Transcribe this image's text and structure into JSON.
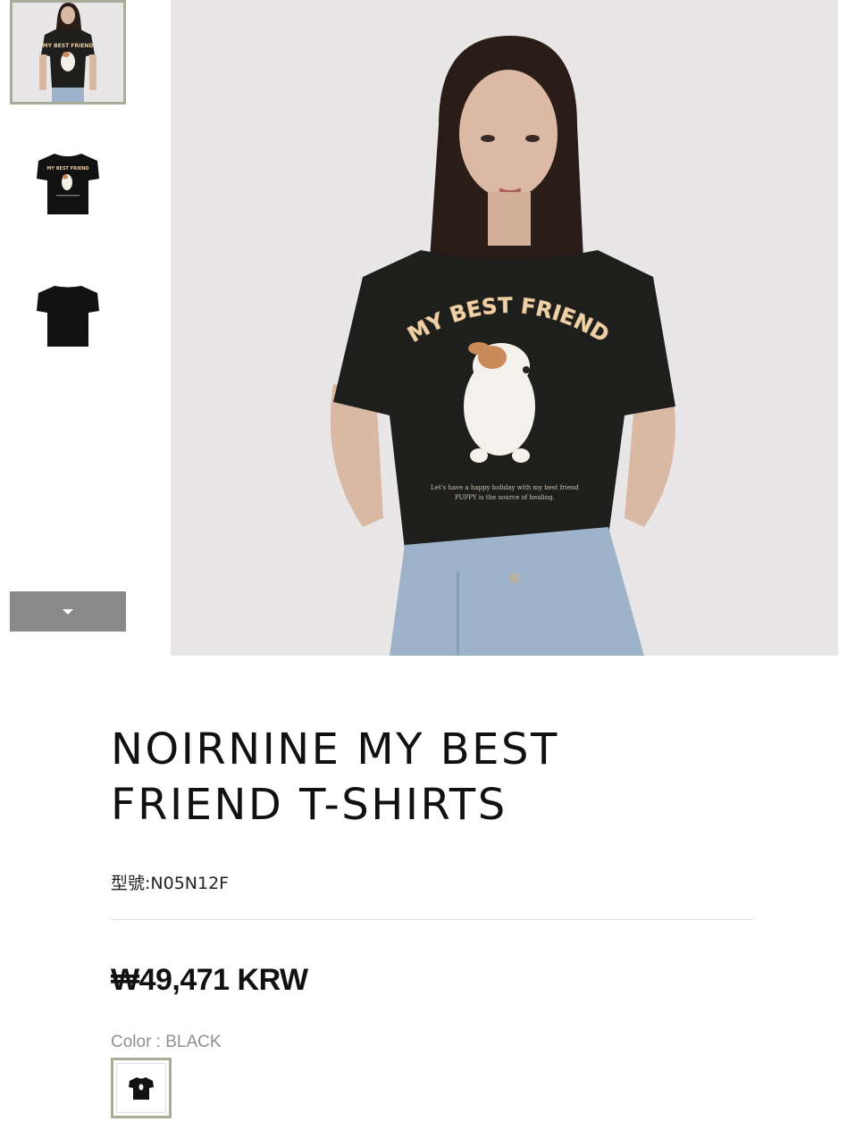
{
  "gallery": {
    "thumbnails": [
      {
        "label": "model-front",
        "selected": true
      },
      {
        "label": "flat-front",
        "selected": false
      },
      {
        "label": "flat-back",
        "selected": false
      }
    ],
    "next_button_icon": "caret-down-icon",
    "main_image": {
      "shirt_print_text": "MY BEST FRIEND",
      "shirt_small_text_1": "Let's have a happy holiday with my best friend",
      "shirt_small_text_2": "PUPPY is the source of healing."
    }
  },
  "product": {
    "title": "NOIRNINE MY BEST FRIEND T-SHIRTS",
    "model": "型號:N05N12F",
    "price": "₩49,471 KRW",
    "color_label": "Color : BLACK"
  },
  "colors": {
    "accent_border": "#a8ad97",
    "shirt": "#1e1f1c",
    "next_button_bg": "#8a8a8a",
    "price_text": "#111111"
  }
}
